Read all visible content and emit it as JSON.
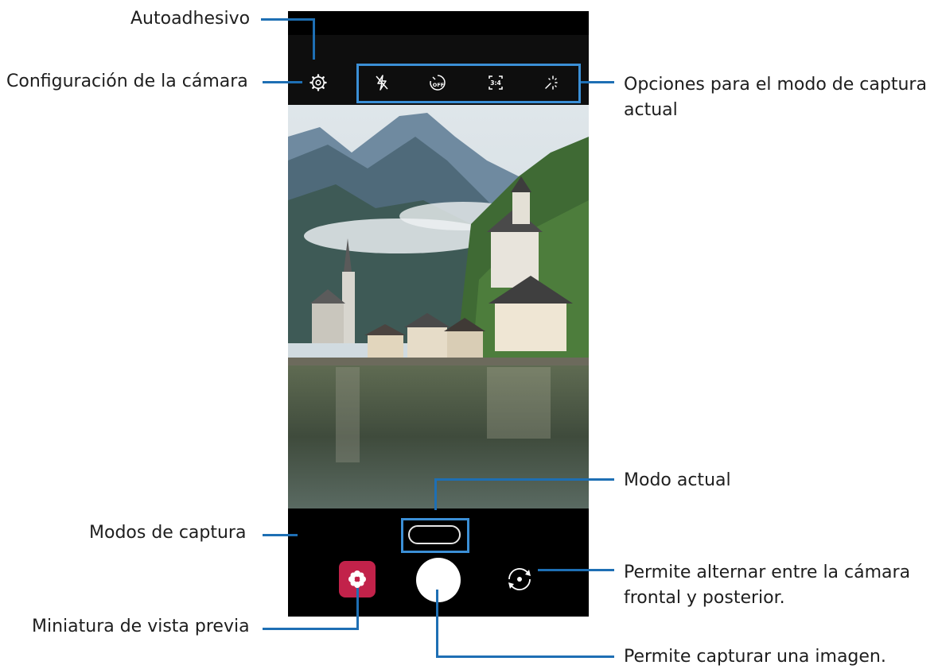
{
  "callouts": {
    "sticker": "Autoadhesivo",
    "settings": "Configuración de la cámara",
    "options_line1": "Opciones para el modo de captura",
    "options_line2": "actual",
    "current_mode": "Modo actual",
    "modes": "Modos de captura",
    "switch_line1": "Permite alternar entre la cámara",
    "switch_line2": "frontal y posterior.",
    "thumbnail": "Miniatura de vista previa",
    "capture": "Permite capturar una imagen."
  },
  "camera": {
    "top_options": [
      {
        "icon": "flash-off-icon"
      },
      {
        "icon": "timer-off-icon"
      },
      {
        "icon": "aspect-ratio-icon"
      },
      {
        "icon": "filter-effects-icon"
      }
    ],
    "settings_icon": "gear-icon",
    "switch_icon": "switch-camera-icon",
    "gallery_icon": "gallery-flower-icon"
  },
  "colors": {
    "accent": "#3b8fd6",
    "leader": "#1e6fb4",
    "gallery": "#c2224a"
  }
}
